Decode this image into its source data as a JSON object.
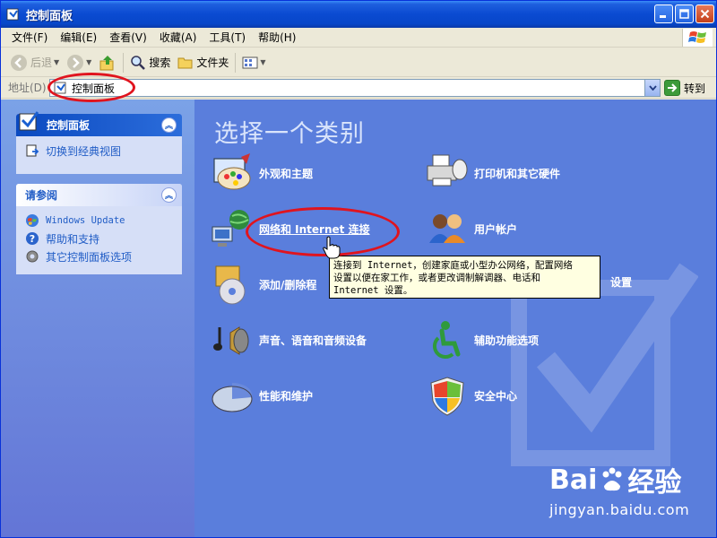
{
  "window": {
    "title": "控制面板"
  },
  "menubar": {
    "items": [
      "文件(F)",
      "编辑(E)",
      "查看(V)",
      "收藏(A)",
      "工具(T)",
      "帮助(H)"
    ]
  },
  "toolbar": {
    "back_label": "后退",
    "search_label": "搜索",
    "folders_label": "文件夹"
  },
  "address": {
    "label": "地址(D)",
    "value": "控制面板",
    "go_label": "转到"
  },
  "sidebar": {
    "panel1": {
      "title": "控制面板",
      "links": [
        "切换到经典视图"
      ]
    },
    "panel2": {
      "title": "请参阅",
      "links": [
        "Windows Update",
        "帮助和支持",
        "其它控制面板选项"
      ]
    }
  },
  "main": {
    "title": "选择一个类别",
    "categories": [
      "外观和主题",
      "打印机和其它硬件",
      "网络和 Internet 连接",
      "用户帐户",
      "添加/删除程",
      "设置",
      "声音、语音和音频设备",
      "辅助功能选项",
      "性能和维护",
      "安全中心"
    ]
  },
  "tooltip": {
    "line1": "连接到 Internet，创建家庭或小型办公网络，配置网络",
    "line2": "设置以便在家工作，或者更改调制解调器、电话和",
    "line3": "Internet 设置。"
  },
  "watermark": {
    "logo_left": "Bai",
    "logo_right": "经验",
    "url": "jingyan.baidu.com"
  },
  "colors": {
    "main_bg": "#5a7edc",
    "sidebar_link": "#215dc6",
    "annotation": "#e0141e",
    "tooltip_bg": "#ffffe1"
  }
}
